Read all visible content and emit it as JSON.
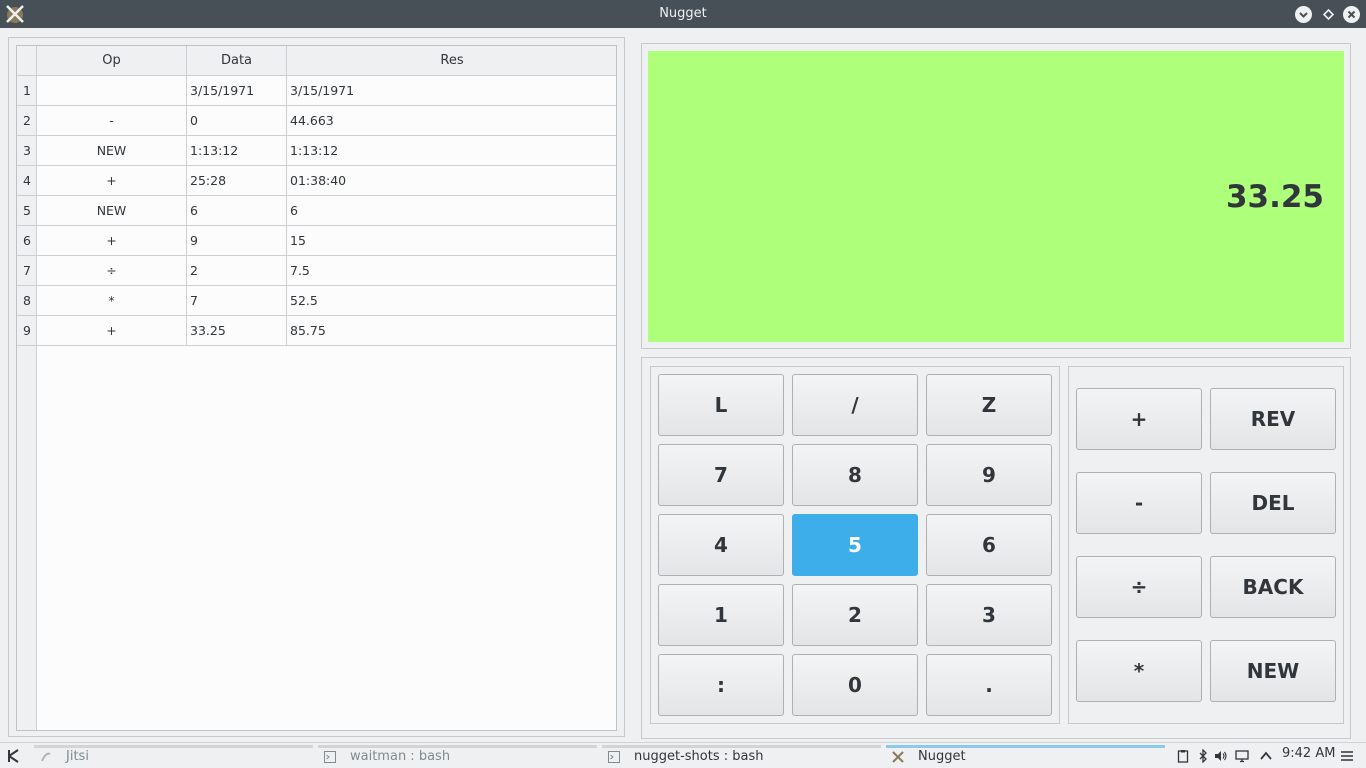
{
  "window": {
    "title": "Nugget"
  },
  "history": {
    "columns": [
      "Op",
      "Data",
      "Res"
    ],
    "rows": [
      {
        "n": "1",
        "op": "",
        "data": "3/15/1971",
        "res": "3/15/1971"
      },
      {
        "n": "2",
        "op": "-",
        "data": "0",
        "res": "44.663"
      },
      {
        "n": "3",
        "op": "NEW",
        "data": "1:13:12",
        "res": "1:13:12"
      },
      {
        "n": "4",
        "op": "+",
        "data": "25:28",
        "res": "01:38:40"
      },
      {
        "n": "5",
        "op": "NEW",
        "data": "6",
        "res": "6"
      },
      {
        "n": "6",
        "op": "+",
        "data": "9",
        "res": "15"
      },
      {
        "n": "7",
        "op": "÷",
        "data": "2",
        "res": "7.5"
      },
      {
        "n": "8",
        "op": "*",
        "data": "7",
        "res": "52.5"
      },
      {
        "n": "9",
        "op": "+",
        "data": "33.25",
        "res": "85.75"
      }
    ]
  },
  "display": {
    "value": "33.25",
    "background": "#aeff7a"
  },
  "numpad": {
    "rows": [
      [
        "L",
        "/",
        "Z"
      ],
      [
        "7",
        "8",
        "9"
      ],
      [
        "4",
        "5",
        "6"
      ],
      [
        "1",
        "2",
        "3"
      ],
      [
        ":",
        "0",
        "."
      ]
    ],
    "active_key": "5"
  },
  "ops": {
    "rows": [
      [
        "+",
        "REV"
      ],
      [
        "-",
        "DEL"
      ],
      [
        "÷",
        "BACK"
      ],
      [
        "*",
        "NEW"
      ]
    ]
  },
  "taskbar": {
    "tasks": [
      {
        "label": "Jitsi",
        "state": "inactive",
        "icon": "jitsi-icon"
      },
      {
        "label": "waitman : bash",
        "state": "inactive",
        "icon": "terminal-icon"
      },
      {
        "label": "nugget-shots : bash",
        "state": "normal",
        "icon": "terminal-icon"
      },
      {
        "label": "Nugget",
        "state": "active",
        "icon": "nugget-icon"
      }
    ],
    "clock": "9:42 AM",
    "tray_icons": [
      "clipboard-icon",
      "bluetooth-icon",
      "volume-icon",
      "display-icon",
      "expand-tray-icon",
      "menu-icon"
    ]
  },
  "colors": {
    "accent": "#3daee9",
    "titlebar": "#475057"
  }
}
